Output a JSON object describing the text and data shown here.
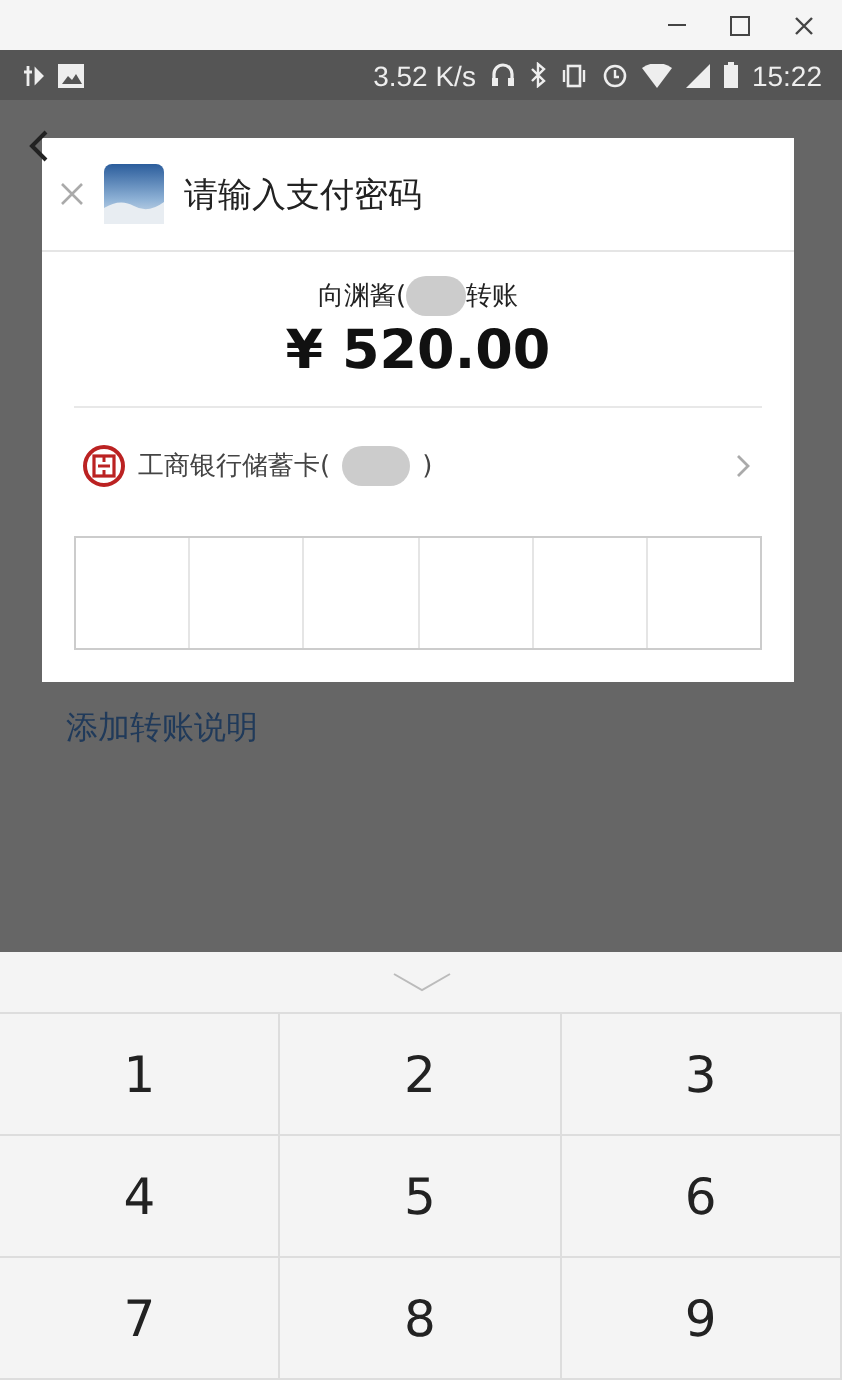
{
  "status_bar": {
    "speed": "3.52 K/s",
    "time": "15:22"
  },
  "background": {
    "add_note_link": "添加转账说明"
  },
  "dialog": {
    "title": "请输入支付密码",
    "recipient_prefix": "向渊酱(",
    "recipient_suffix": "转账",
    "amount": "¥ 520.00",
    "card_prefix": "工商银行储蓄卡(",
    "card_suffix": ")"
  },
  "keypad": {
    "keys": [
      "1",
      "2",
      "3",
      "4",
      "5",
      "6",
      "7",
      "8",
      "9"
    ]
  }
}
